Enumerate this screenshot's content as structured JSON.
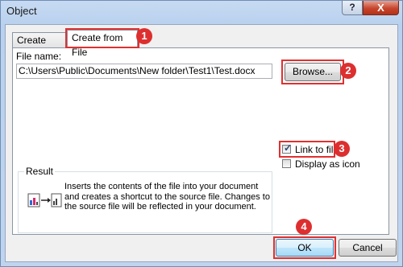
{
  "window": {
    "title": "Object",
    "help_label": "?",
    "close_label": "X"
  },
  "tabs": [
    {
      "label": "Create New",
      "active": false
    },
    {
      "label": "Create from File",
      "active": true
    }
  ],
  "file": {
    "label": "File name:",
    "value": "C:\\Users\\Public\\Documents\\New folder\\Test1\\Test.docx",
    "browse_label": "Browse..."
  },
  "options": {
    "link_to_file": {
      "label": "Link to file",
      "checked": true
    },
    "display_as_icon": {
      "label": "Display as icon",
      "checked": false
    }
  },
  "result": {
    "label": "Result",
    "text": "Inserts the contents of the file into your document and creates a shortcut to the source file.  Changes to the source file will be reflected in your document."
  },
  "buttons": {
    "ok": "OK",
    "cancel": "Cancel"
  },
  "annotations": {
    "badges": [
      "1",
      "2",
      "3",
      "4"
    ],
    "color": "#dd2f2f"
  }
}
